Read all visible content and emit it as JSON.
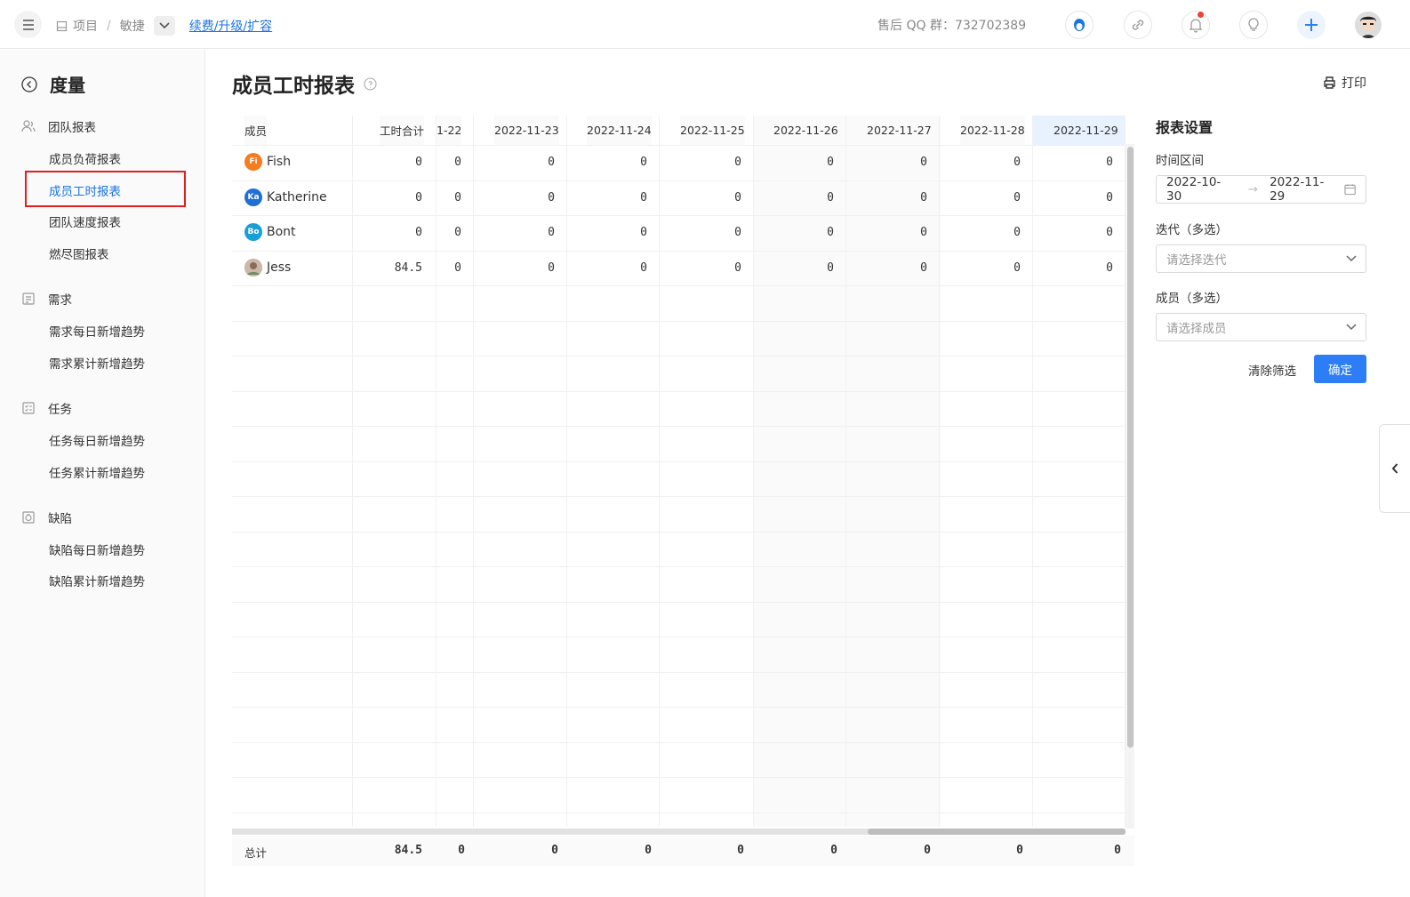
{
  "topbar": {
    "breadcrumb_project": "项目",
    "breadcrumb_sep": "/",
    "breadcrumb_agile": "敏捷",
    "renew_link": "续费/升级/扩容",
    "qq_group": "售后 QQ 群：732702389"
  },
  "sidebar": {
    "title": "度量",
    "groups": [
      {
        "label": "团队报表",
        "items": [
          "成员负荷报表",
          "成员工时报表",
          "团队速度报表",
          "燃尽图报表"
        ]
      },
      {
        "label": "需求",
        "items": [
          "需求每日新增趋势",
          "需求累计新增趋势"
        ]
      },
      {
        "label": "任务",
        "items": [
          "任务每日新增趋势",
          "任务累计新增趋势"
        ]
      },
      {
        "label": "缺陷",
        "items": [
          "缺陷每日新增趋势",
          "缺陷累计新增趋势"
        ]
      }
    ],
    "active_item": "成员工时报表"
  },
  "page": {
    "title": "成员工时报表",
    "print_label": "打印"
  },
  "table": {
    "headers": [
      "成员",
      "工时合计",
      "1-22",
      "2022-11-23",
      "2022-11-24",
      "2022-11-25",
      "2022-11-26",
      "2022-11-27",
      "2022-11-28",
      "2022-11-29"
    ],
    "rows": [
      {
        "initials": "Fi",
        "avatar_color": "#f57c1f",
        "name": "Fish",
        "total": "0",
        "values": [
          "0",
          "0",
          "0",
          "0",
          "0",
          "0",
          "0",
          "0"
        ]
      },
      {
        "initials": "Ka",
        "avatar_color": "#1f6fd6",
        "name": "Katherine",
        "total": "0",
        "values": [
          "0",
          "0",
          "0",
          "0",
          "0",
          "0",
          "0",
          "0"
        ]
      },
      {
        "initials": "Bo",
        "avatar_color": "#1a9ed8",
        "name": "Bont",
        "total": "0",
        "values": [
          "0",
          "0",
          "0",
          "0",
          "0",
          "0",
          "0",
          "0"
        ]
      },
      {
        "initials": "",
        "avatar_color": "#b59a8a",
        "name": "Jess",
        "total": "84.5",
        "values": [
          "0",
          "0",
          "0",
          "0",
          "0",
          "0",
          "0",
          "0"
        ]
      }
    ],
    "footer": {
      "label": "总计",
      "total": "84.5",
      "values": [
        "0",
        "0",
        "0",
        "0",
        "0",
        "0",
        "0",
        "0"
      ]
    }
  },
  "settings": {
    "title": "报表设置",
    "time_label": "时间区间",
    "date_start": "2022-10-30",
    "date_end": "2022-11-29",
    "iteration_label": "迭代（多选）",
    "iteration_placeholder": "请选择迭代",
    "member_label": "成员（多选）",
    "member_placeholder": "请选择成员",
    "clear_label": "清除筛选",
    "ok_label": "确定"
  },
  "colors": {
    "accent": "#2d7df6",
    "link": "#1a73e8",
    "highlight_border": "#e02020"
  }
}
